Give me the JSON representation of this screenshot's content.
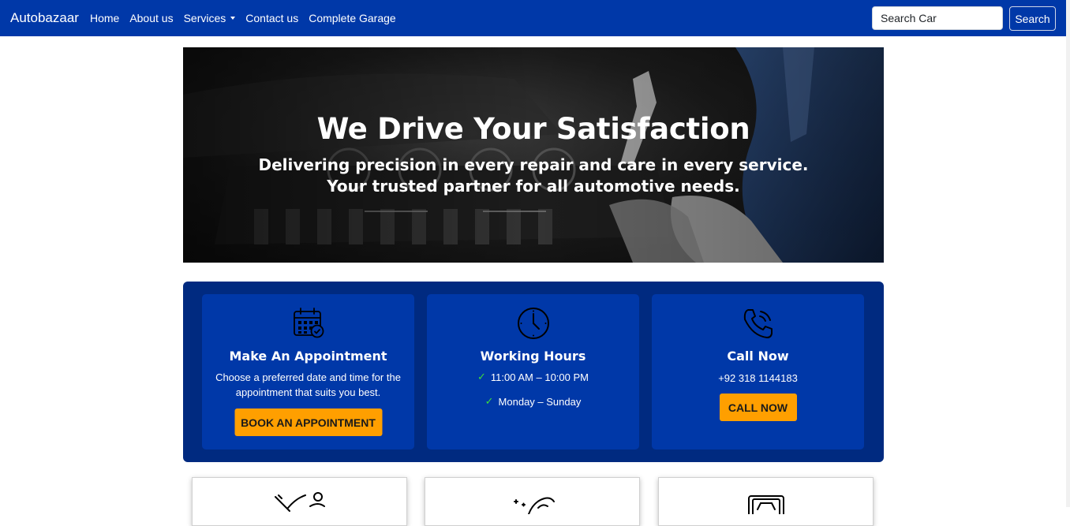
{
  "navbar": {
    "brand": "Autobazaar",
    "links": [
      "Home",
      "About us",
      "Services",
      "Contact us",
      "Complete Garage"
    ],
    "search": {
      "placeholder": "Search Car",
      "button": "Search"
    }
  },
  "hero": {
    "title": "We Drive Your Satisfaction",
    "subtitle_line1": "Delivering precision in every repair and care in every service.",
    "subtitle_line2": "Your trusted partner for all automotive needs."
  },
  "info_cards": [
    {
      "icon": "calendar-icon",
      "title": "Make An Appointment",
      "text": "Choose a preferred date and time for the appointment that suits you best.",
      "button": "BOOK AN APPOINTMENT"
    },
    {
      "icon": "clock-icon",
      "title": "Working Hours",
      "hours": "11:00 AM – 10:00 PM",
      "days": "Monday – Sunday"
    },
    {
      "icon": "phone-icon",
      "title": "Call Now",
      "phone": "+92 318 1144183",
      "button": "CALL NOW"
    }
  ],
  "service_cards": [
    {
      "icon": "mechanic-icon"
    },
    {
      "icon": "car-wash-icon"
    },
    {
      "icon": "car-interior-icon"
    }
  ],
  "colors": {
    "navbar": "#0038a8",
    "panel": "#002a80",
    "card": "#0038a8",
    "accent": "#ff9f00",
    "check": "#3ddc3d"
  }
}
